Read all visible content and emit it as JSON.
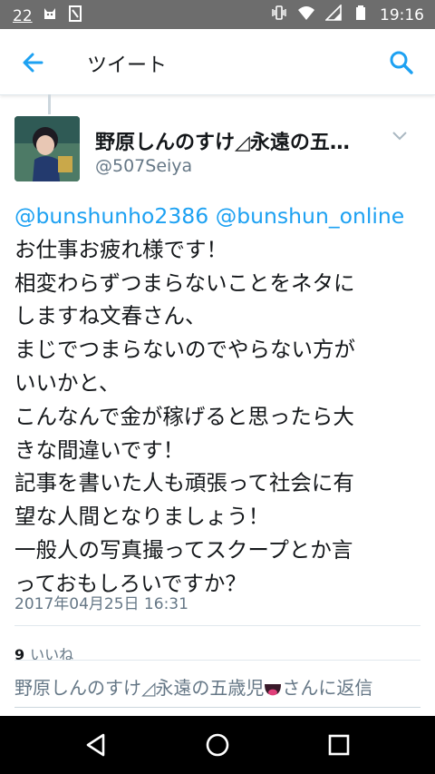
{
  "status_bar": {
    "notification_count": "22",
    "time": "19:16",
    "icons": [
      "vibrate-icon",
      "wifi-icon",
      "signal-icon",
      "battery-icon"
    ]
  },
  "app_bar": {
    "title": "ツイート",
    "back_icon": "arrow-left-icon",
    "search_icon": "search-icon",
    "accent_color": "#1da1f2"
  },
  "tweet": {
    "author": {
      "name": "野原しんのすけ◿永遠の五…",
      "handle": "@507Seiya"
    },
    "mentions": [
      "@bunshunho2386",
      "@bunshun_online"
    ],
    "lines": [
      "お仕事お疲れ様です！",
      "相変わらずつまらないことをネタに",
      "しますね文春さん、",
      "まじでつまらないのでやらない方が",
      "いいかと、",
      "こんなんで金が稼げると思ったら大",
      "きな間違いです！",
      "記事を書いた人も頑張って社会に有",
      "望な人間となりましょう！",
      "一般人の写真撮ってスクープとか言",
      "っておもしろいですか？"
    ],
    "timestamp": "2017年04月25日 16:31",
    "likes_count": "9",
    "likes_label": "いいね"
  },
  "reply": {
    "prefix": "野原しんのすけ◿永遠の五歳児",
    "suffix": "さんに返信"
  },
  "nav_bar": {
    "icons": [
      "back-triangle-icon",
      "home-circle-icon",
      "recents-square-icon"
    ]
  }
}
